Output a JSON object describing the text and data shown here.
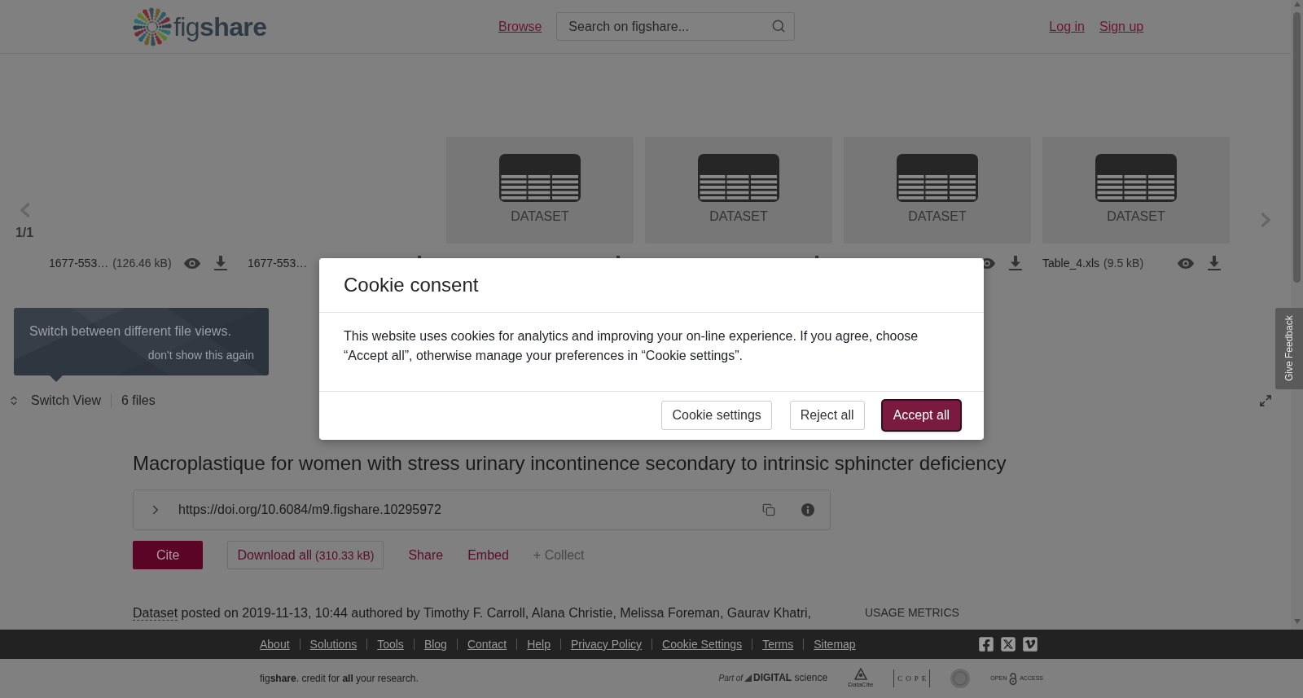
{
  "header": {
    "logo": "fig**share**",
    "nav_link": "Browse",
    "search": {
      "placeholder": "Search on figshare..."
    },
    "account_links": [
      "Log in",
      "Sign up"
    ]
  },
  "file_viewer": {
    "page_indicator": "1/1",
    "files": [
      {
        "kind": "blank",
        "name": "1677-553…",
        "size": "(126.46 kB)"
      },
      {
        "kind": "blank",
        "name": "1677-553…"
      },
      {
        "kind": "dataset",
        "thumbnail_label": "DATASET"
      },
      {
        "kind": "dataset",
        "thumbnail_label": "DATASET"
      },
      {
        "kind": "dataset",
        "thumbnail_label": "DATASET"
      },
      {
        "kind": "dataset",
        "thumbnail_label": "DATASET",
        "name": "Table_4.xls",
        "size": "(9.5 kB)"
      }
    ],
    "tooltip": {
      "text": "Switch between different file views.",
      "dismiss_link": "don't show this again"
    },
    "toolbar": {
      "switch_view": "Switch View",
      "file_count": "6 files"
    }
  },
  "article": {
    "title": "Macroplastique for women with stress urinary incontinence secondary to intrinsic sphincter deficiency",
    "doi": "https://doi.org/10.6084/m9.figshare.10295972",
    "actions": [
      {
        "kind": "primary",
        "label": "Cite"
      },
      {
        "kind": "outline",
        "label": "Download all",
        "detail": "(310.33 kB)"
      },
      {
        "kind": "link",
        "label": "Share"
      },
      {
        "kind": "link",
        "label": "Embed"
      },
      {
        "kind": "muted",
        "label": "+ Collect"
      }
    ],
    "meta": {
      "item_type": "Dataset",
      "text": "posted on 2019-11-13, 10:44 authored by Timothy F. Carroll, Alana Christie, Melissa Foreman, Gaurav Khatri,"
    },
    "side_heading": "USAGE METRICS"
  },
  "footer": {
    "links": [
      "About",
      "Solutions",
      "Tools",
      "Blog",
      "Contact",
      "Help",
      "Privacy Policy",
      "Cookie Settings",
      "Terms",
      "Sitemap"
    ],
    "social": [
      {
        "kind": "facebook"
      },
      {
        "kind": "x"
      },
      {
        "kind": "vimeo"
      }
    ],
    "tagline": "fig**share**. credit for **all** your research.",
    "partners": [
      {
        "kind": "digital_science",
        "prefix": "Part of",
        "name": "**DIGITAL** science"
      },
      {
        "kind": "datacite",
        "name": "DataCite"
      },
      {
        "kind": "cope",
        "name": "COPE"
      },
      {
        "kind": "seal"
      },
      {
        "kind": "open_access",
        "prefix": "OPEN",
        "name": "ACCESS"
      }
    ]
  },
  "feedback_tab": "Give Feedback",
  "cookie_dialog": {
    "title": "Cookie consent",
    "body": "This website uses cookies for analytics and improving your on-line experience. If you agree, choose “Accept all”, otherwise manage your preferences in “Cookie settings”.",
    "buttons": [
      {
        "kind": "secondary",
        "label": "Cookie settings",
        "focused": false
      },
      {
        "kind": "secondary",
        "label": "Reject all",
        "focused": false
      },
      {
        "kind": "primary",
        "label": "Accept all",
        "focused": true
      }
    ]
  }
}
